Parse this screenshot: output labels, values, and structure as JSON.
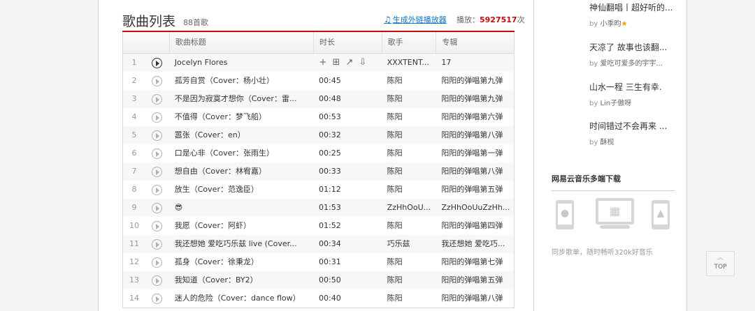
{
  "header": {
    "title": "歌曲列表",
    "count": "88首歌",
    "ext_link": "生成外链播放器",
    "play_label": "播放：",
    "play_count": "5927517",
    "play_unit": "次"
  },
  "table": {
    "columns": [
      "",
      "歌曲标题",
      "时长",
      "歌手",
      "专辑"
    ],
    "rows": [
      {
        "index": "1",
        "title": "Jocelyn Flores",
        "duration": "",
        "artist": "XXXTENT...",
        "album": "17"
      },
      {
        "index": "2",
        "title": "孤芳自赏（Cover：杨小壮）",
        "duration": "00:45",
        "artist": "陈阳",
        "album": "阳阳的弹唱第九弹"
      },
      {
        "index": "3",
        "title": "不是因为寂寞才想你（Cover：雷...",
        "duration": "00:48",
        "artist": "陈阳",
        "album": "阳阳的弹唱第九弹"
      },
      {
        "index": "4",
        "title": "不值得（Cover：梦飞船）",
        "duration": "00:53",
        "artist": "陈阳",
        "album": "阳阳的弹唱第六弹"
      },
      {
        "index": "5",
        "title": "嚣张（Cover：en）",
        "duration": "00:32",
        "artist": "陈阳",
        "album": "阳阳的弹唱第八弹"
      },
      {
        "index": "6",
        "title": "口是心非（Cover：张雨生）",
        "duration": "00:25",
        "artist": "陈阳",
        "album": "阳阳的弹唱第一弹"
      },
      {
        "index": "7",
        "title": "想自由（Cover：林宥嘉）",
        "duration": "00:33",
        "artist": "陈阳",
        "album": "阳阳的弹唱第八弹"
      },
      {
        "index": "8",
        "title": "放生（Cover：范逸臣）",
        "duration": "01:12",
        "artist": "陈阳",
        "album": "阳阳的弹唱第五弹"
      },
      {
        "index": "9",
        "title": "😎",
        "duration": "01:53",
        "artist": "ZzHhOoU...",
        "album": "ZzHhOoUuZzHh..."
      },
      {
        "index": "10",
        "title": "我愿（Cover：阿虾）",
        "duration": "01:52",
        "artist": "陈阳",
        "album": "阳阳的弹唱第四弹"
      },
      {
        "index": "11",
        "title": "我还想她 爱吃巧乐兹 live (Cover...",
        "duration": "00:34",
        "artist": "巧乐兹",
        "album": "我还想她 爱吃巧..."
      },
      {
        "index": "12",
        "title": "孤身（Cover：徐秉龙）",
        "duration": "00:31",
        "artist": "陈阳",
        "album": "阳阳的弹唱第七弹"
      },
      {
        "index": "13",
        "title": "我知道（Cover：BY2）",
        "duration": "00:50",
        "artist": "陈阳",
        "album": "阳阳的弹唱第五弹"
      },
      {
        "index": "14",
        "title": "迷人的危险（Cover：dance flow）",
        "duration": "00:40",
        "artist": "陈阳",
        "album": "阳阳的弹唱第八弹"
      }
    ]
  },
  "sidebar": {
    "playlists": [
      {
        "title": "神仙翻唱丨超好听的...",
        "by": "by",
        "user": "小季昀"
      },
      {
        "title": "天凉了 故事也该翻...",
        "by": "by",
        "user": "爱吃可爱多的宇宇..."
      },
      {
        "title": "山水一程 三生有幸.",
        "by": "by",
        "user": "Lin子傲呀"
      },
      {
        "title": "时间错过不会再来 ...",
        "by": "by",
        "user": "酥枧"
      }
    ],
    "download_title": "网易云音乐多端下载",
    "download_text": "同步歌单，随时畅听320k好音乐"
  },
  "top_button": "TOP"
}
